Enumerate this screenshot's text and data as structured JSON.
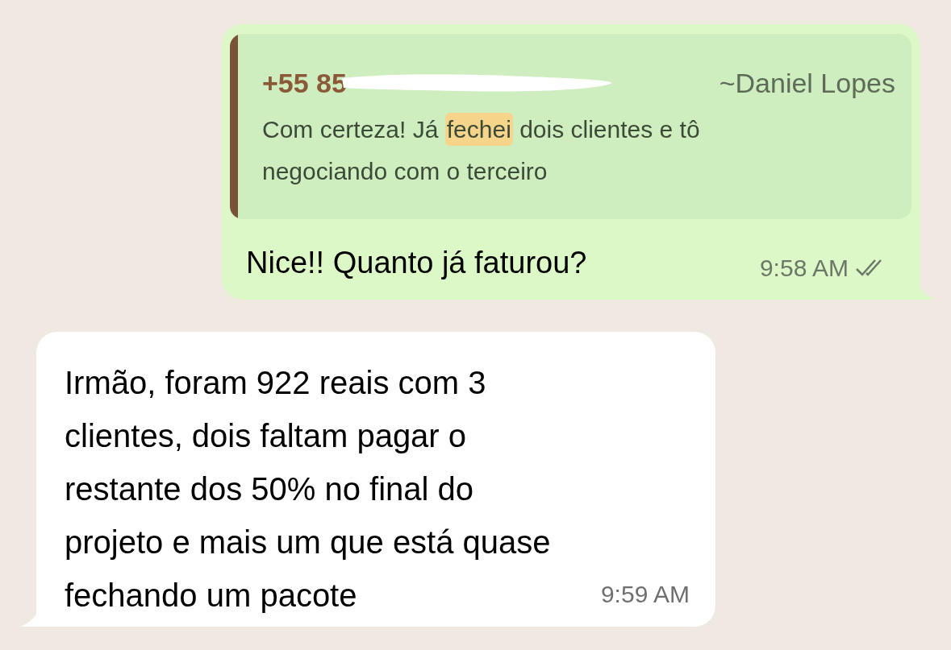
{
  "outgoing": {
    "quote": {
      "sender_number": "+55 85",
      "redacted": true,
      "sender_name": "~Daniel Lopes",
      "segments": [
        {
          "text": "Com certeza! Já ",
          "highlighted": false
        },
        {
          "text": "fechei",
          "highlighted": true
        },
        {
          "text": " dois clientes e tô\nnegociando com o terceiro",
          "highlighted": false
        }
      ]
    },
    "text": "Nice!! Quanto já faturou?",
    "time": "9:58 AM",
    "read": false
  },
  "incoming": {
    "lines": [
      "Irmão, foram 922 reais com 3",
      "clientes, dois faltam pagar o",
      "restante dos 50% no final do",
      "projeto e mais um que está quase",
      "fechando um pacote"
    ],
    "time": "9:59 AM"
  }
}
